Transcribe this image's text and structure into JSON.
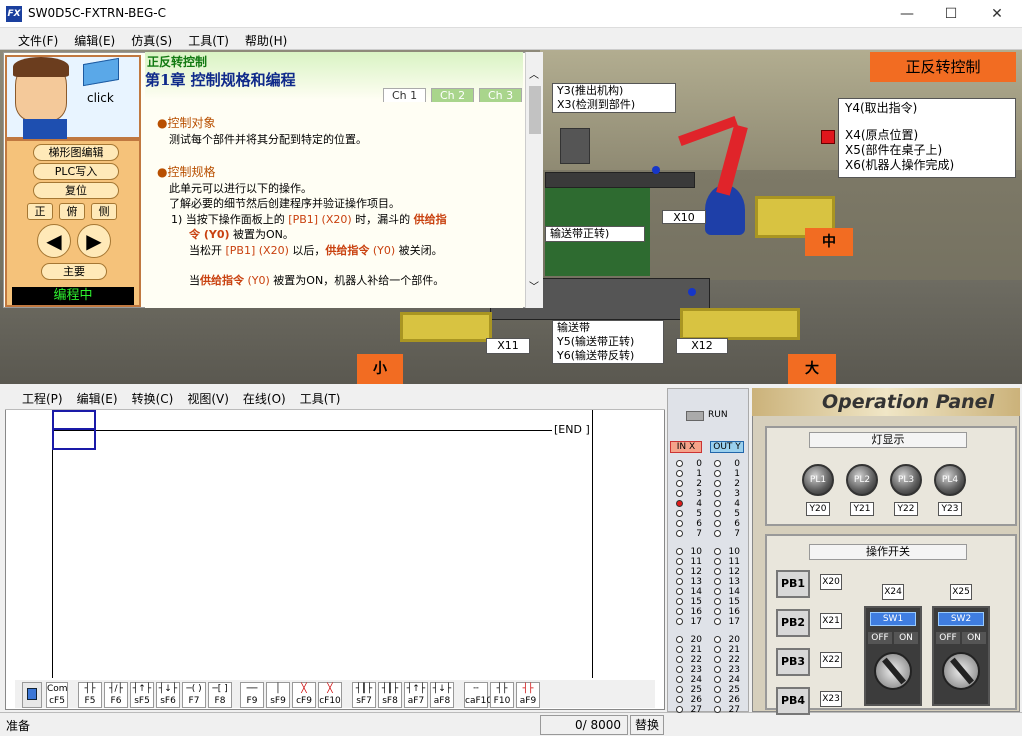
{
  "window": {
    "title": "SW0D5C-FXTRN-BEG-C",
    "logo": "FX",
    "min": "—",
    "max": "☐",
    "close": "✕"
  },
  "menu": [
    "文件(F)",
    "编辑(E)",
    "仿真(S)",
    "工具(T)",
    "帮助(H)"
  ],
  "scene": {
    "title_button": "正反转控制",
    "labels": {
      "y3x3": [
        "Y3(推出机构)",
        "X3(检测到部件)"
      ],
      "x10": "X10",
      "conv_fwd": "输送带正转)",
      "x11": "X11",
      "x12": "X12",
      "conv": [
        "输送带",
        "Y5(输送带正转)",
        "Y6(输送带反转)"
      ],
      "right": [
        "Y4(取出指令)",
        "X4(原点位置)",
        "X5(部件在桌子上)",
        "X6(机器人操作完成)"
      ]
    },
    "bins": {
      "small": "小",
      "mid": "中",
      "big": "大"
    }
  },
  "left": {
    "click": "click",
    "btn_ladder": "梯形图编辑",
    "btn_plc": "PLC写入",
    "btn_reset": "复位",
    "views": [
      "正",
      "俯",
      "侧"
    ],
    "main": "主要",
    "status": "编程中"
  },
  "doc": {
    "subtitle": "正反转控制",
    "title": "第1章    控制规格和编程",
    "tabs": [
      "Ch 1",
      "Ch 2",
      "Ch 3"
    ],
    "s1_head": "控制对象",
    "s1_body": "测试每个部件并将其分配到特定的位置。",
    "s2_head": "控制规格",
    "s2_l1": "此单元可以进行以下的操作。",
    "s2_l2": "了解必要的细节然后创建程序并验证操作项目。",
    "item1_a": "1) 当按下操作面板上的 ",
    "item1_b": "[PB1] (X20)",
    "item1_c": " 时，漏斗的 ",
    "item1_d": "供给指",
    "item1_e": "令 (Y0)",
    "item1_f": " 被置为ON。",
    "item1_g": "当松开 ",
    "item1_h": "[PB1] (X20)",
    "item1_i": " 以后，",
    "item1_j": "供给指令",
    "item1_k": " (Y0)",
    "item1_l": " 被关闭。",
    "item1_m": "当",
    "item1_n": "供给指令",
    "item1_o": " (Y0)",
    "item1_p": " 被置为ON，机器人补给一个部件。"
  },
  "ladder": {
    "menu": [
      "工程(P)",
      "编辑(E)",
      "转换(C)",
      "视图(V)",
      "在线(O)",
      "工具(T)"
    ],
    "end": "END"
  },
  "fkeys": [
    "cF5",
    "F5",
    "F6",
    "sF5",
    "sF6",
    "F7",
    "F8",
    "F9",
    "sF9",
    "cF9",
    "cF10",
    "sF7",
    "sF8",
    "aF7",
    "aF8",
    "caF10",
    "F10",
    "aF9"
  ],
  "fkey_com": "Com",
  "statusbar": {
    "left": "准备",
    "steps": "0/ 8000",
    "mode": "替换"
  },
  "io": {
    "run": "RUN",
    "in": "IN X",
    "out": "OUT Y",
    "groups": [
      [
        "0",
        "1",
        "2",
        "3",
        "4",
        "5",
        "6",
        "7"
      ],
      [
        "10",
        "11",
        "12",
        "13",
        "14",
        "15",
        "16",
        "17"
      ],
      [
        "20",
        "21",
        "22",
        "23",
        "24",
        "25",
        "26",
        "27"
      ]
    ],
    "active_in": "4"
  },
  "op": {
    "title": "Operation Panel",
    "lamp_title": "灯显示",
    "lamps": [
      "PL1",
      "PL2",
      "PL3",
      "PL4"
    ],
    "ylabels": [
      "Y20",
      "Y21",
      "Y22",
      "Y23"
    ],
    "sw_title": "操作开关",
    "pbs": [
      "PB1",
      "PB2",
      "PB3",
      "PB4"
    ],
    "xlabels": [
      "X20",
      "X21",
      "X22",
      "X23"
    ],
    "sw": [
      {
        "x": "X24",
        "name": "SW1"
      },
      {
        "x": "X25",
        "name": "SW2"
      }
    ],
    "off": "OFF",
    "on": "ON"
  }
}
